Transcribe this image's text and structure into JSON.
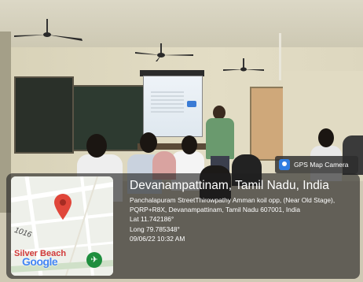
{
  "photo": {
    "subject": "classroom-lecture-with-projector"
  },
  "watermark": {
    "badge_label": "GPS Map Camera",
    "location_title": "Devanampattinam, Tamil Nadu, India",
    "address": "Panchalapuram StreetThirowpathy Amman koil opp, (Near Old Stage), PQRP+R8X, Devanampattinam, Tamil Nadu 607001, India",
    "latitude": "Lat 11.742186°",
    "longitude": "Long 79.785348°",
    "timestamp": "09/06/22 10:32 AM"
  },
  "map": {
    "place_label": "Silver Beach",
    "road_number": "1016",
    "provider": "Google"
  },
  "colors": {
    "pin": "#e0463a",
    "provider_g": "#4285f4",
    "provider_o1": "#ea4335",
    "provider_o2": "#fbbc05",
    "provider_l": "#34a853",
    "poi_badge": "#1e8e3e"
  }
}
